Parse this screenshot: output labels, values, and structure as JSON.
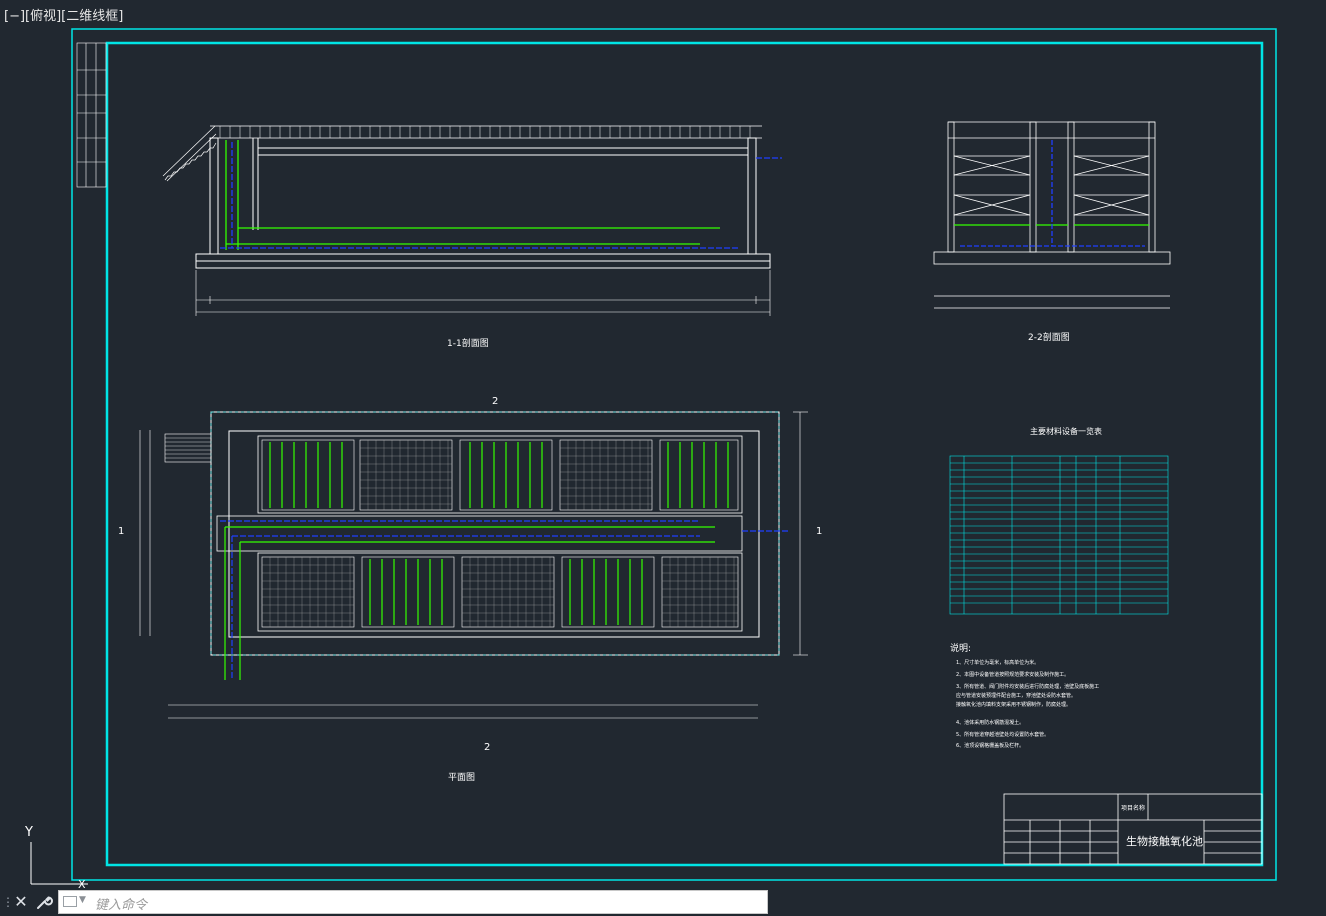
{
  "viewport": {
    "label": "[−][俯视][二维线框]"
  },
  "drawing": {
    "section_1_title": "1-1剖面图",
    "section_2_title": "2-2剖面图",
    "plan_title": "平面图",
    "section_mark_top": "2",
    "section_mark_bottom": "2",
    "section_mark_left": "1",
    "section_mark_right": "1",
    "table_title": "主要材料设备一览表",
    "notes_title": "说明:",
    "notes": [
      "1、尺寸单位为毫米，标高单位为米。",
      "2、本图中设备管道按照规范要求安装及制作施工。",
      "3、所有管道、阀门附件均安装后进行防腐处理，池壁及底板施工",
      "   应与管道安装预埋件配合施工，穿池壁处设防水套管。",
      "   接触氧化池内填料支架采用不锈钢制作，防腐处理。",
      "4、池体采用防水钢筋混凝土。",
      "5、所有管道穿越池壁处均设置防水套管。",
      "6、池顶设钢格栅盖板及栏杆。"
    ],
    "title_block": {
      "drawing_name": "生物接触氧化池",
      "project_label": "项目名称"
    }
  },
  "colors": {
    "background": "#212830",
    "frame": "#00ffff",
    "lines": "#ffffff",
    "pipe_green": "#33ff00",
    "pipe_blue": "#1f3fff",
    "yellow": "#ffff00"
  },
  "ucs": {
    "y_label": "Y",
    "x_label": "X"
  },
  "command_line": {
    "placeholder": "键入命令",
    "close_icon": "close-icon",
    "tools_icon": "wrench-icon"
  }
}
